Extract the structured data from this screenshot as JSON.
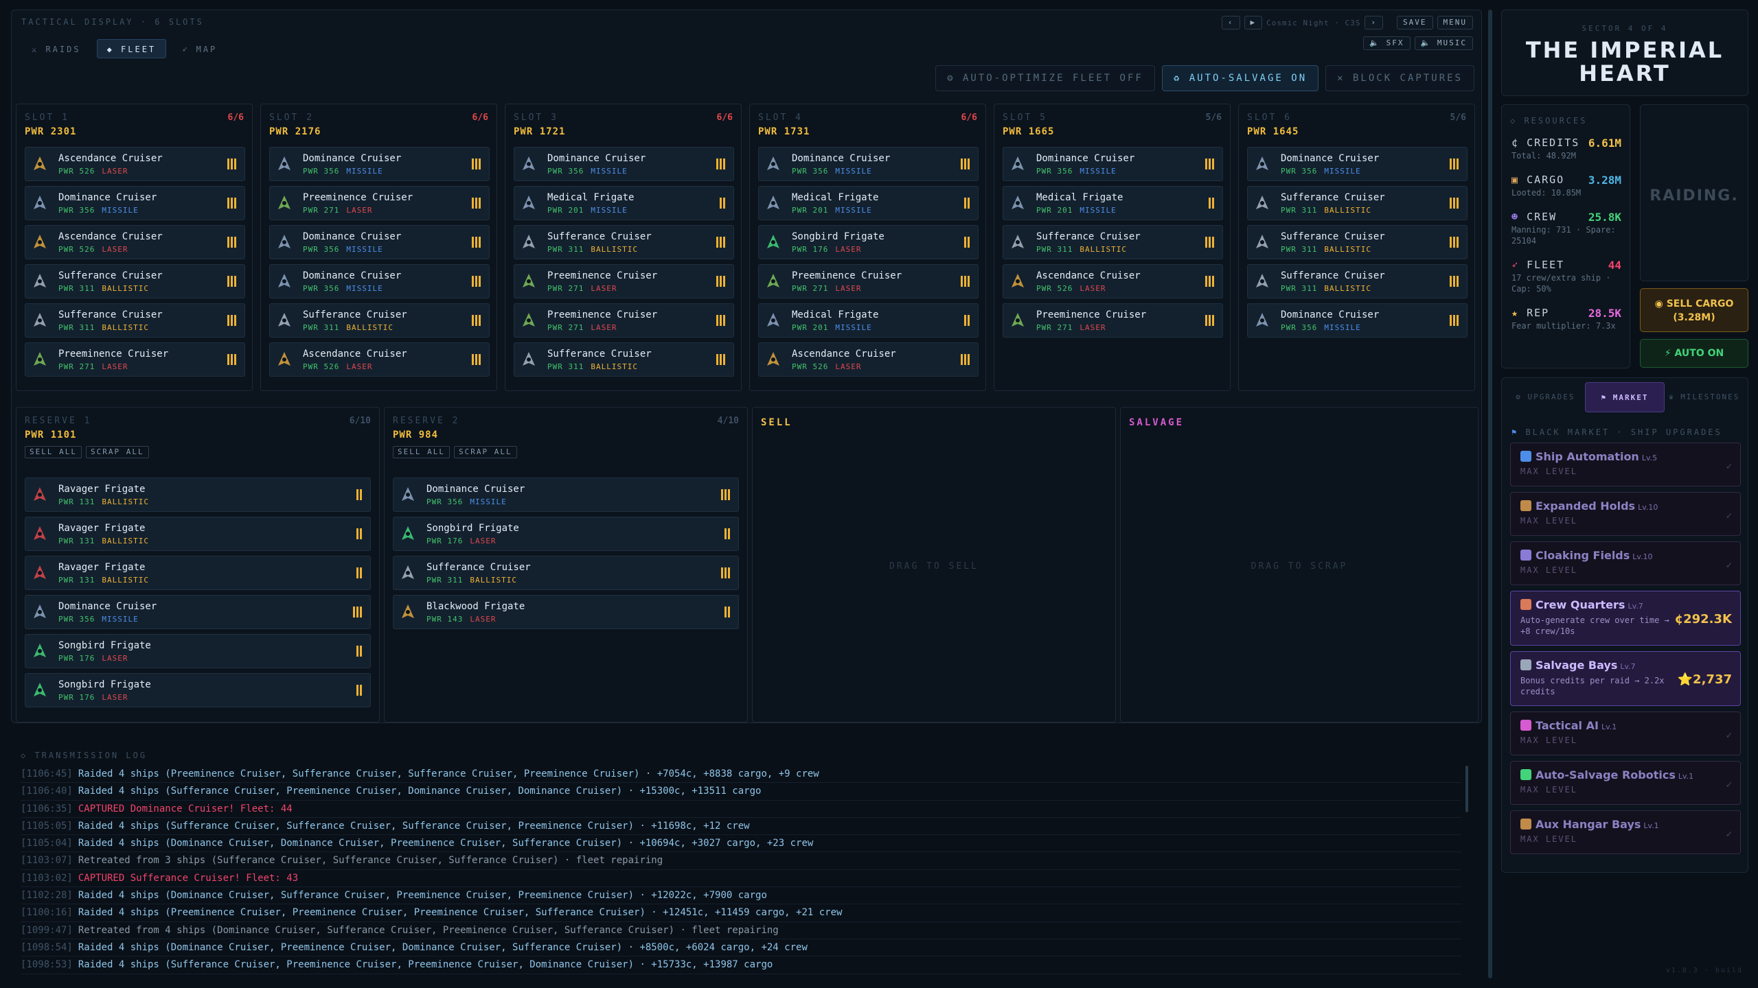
{
  "header": {
    "title": "TACTICAL DISPLAY · 6 SLOTS",
    "tabs": [
      {
        "label": "RAIDS",
        "icon": "crossed-swords-icon"
      },
      {
        "label": "FLEET",
        "icon": "diamond-icon",
        "active": true
      },
      {
        "label": "MAP",
        "icon": "rocket-icon"
      }
    ],
    "controls": {
      "save": "SAVE",
      "menu": "MENU",
      "status": "Cosmic Night · C3S",
      "sfx": "SFX",
      "music": "MUSIC"
    }
  },
  "actions": {
    "auto_optimize": "AUTO-OPTIMIZE FLEET OFF",
    "auto_salvage": "AUTO-SALVAGE ON",
    "block_captures": "BLOCK CAPTURES"
  },
  "slots": [
    {
      "label": "SLOT 1",
      "count": "6/6",
      "pwr": "PWR 2301",
      "ships": [
        {
          "name": "Ascendance Cruiser",
          "pwr": "PWR 526",
          "type": "LASER",
          "bars": 3
        },
        {
          "name": "Dominance Cruiser",
          "pwr": "PWR 356",
          "type": "MISSILE",
          "bars": 3
        },
        {
          "name": "Ascendance Cruiser",
          "pwr": "PWR 526",
          "type": "LASER",
          "bars": 3
        },
        {
          "name": "Sufferance Cruiser",
          "pwr": "PWR 311",
          "type": "BALLISTIC",
          "bars": 3
        },
        {
          "name": "Sufferance Cruiser",
          "pwr": "PWR 311",
          "type": "BALLISTIC",
          "bars": 3
        },
        {
          "name": "Preeminence Cruiser",
          "pwr": "PWR 271",
          "type": "LASER",
          "bars": 3
        }
      ]
    },
    {
      "label": "SLOT 2",
      "count": "6/6",
      "pwr": "PWR 2176",
      "ships": [
        {
          "name": "Dominance Cruiser",
          "pwr": "PWR 356",
          "type": "MISSILE",
          "bars": 3
        },
        {
          "name": "Preeminence Cruiser",
          "pwr": "PWR 271",
          "type": "LASER",
          "bars": 3
        },
        {
          "name": "Dominance Cruiser",
          "pwr": "PWR 356",
          "type": "MISSILE",
          "bars": 3
        },
        {
          "name": "Dominance Cruiser",
          "pwr": "PWR 356",
          "type": "MISSILE",
          "bars": 3
        },
        {
          "name": "Sufferance Cruiser",
          "pwr": "PWR 311",
          "type": "BALLISTIC",
          "bars": 3
        },
        {
          "name": "Ascendance Cruiser",
          "pwr": "PWR 526",
          "type": "LASER",
          "bars": 3
        }
      ]
    },
    {
      "label": "SLOT 3",
      "count": "6/6",
      "pwr": "PWR 1721",
      "ships": [
        {
          "name": "Dominance Cruiser",
          "pwr": "PWR 356",
          "type": "MISSILE",
          "bars": 3
        },
        {
          "name": "Medical Frigate",
          "pwr": "PWR 201",
          "type": "MISSILE",
          "bars": 2
        },
        {
          "name": "Sufferance Cruiser",
          "pwr": "PWR 311",
          "type": "BALLISTIC",
          "bars": 3
        },
        {
          "name": "Preeminence Cruiser",
          "pwr": "PWR 271",
          "type": "LASER",
          "bars": 3
        },
        {
          "name": "Preeminence Cruiser",
          "pwr": "PWR 271",
          "type": "LASER",
          "bars": 3
        },
        {
          "name": "Sufferance Cruiser",
          "pwr": "PWR 311",
          "type": "BALLISTIC",
          "bars": 3
        }
      ]
    },
    {
      "label": "SLOT 4",
      "count": "6/6",
      "pwr": "PWR 1731",
      "ships": [
        {
          "name": "Dominance Cruiser",
          "pwr": "PWR 356",
          "type": "MISSILE",
          "bars": 3
        },
        {
          "name": "Medical Frigate",
          "pwr": "PWR 201",
          "type": "MISSILE",
          "bars": 2
        },
        {
          "name": "Songbird Frigate",
          "pwr": "PWR 176",
          "type": "LASER",
          "bars": 2
        },
        {
          "name": "Preeminence Cruiser",
          "pwr": "PWR 271",
          "type": "LASER",
          "bars": 3
        },
        {
          "name": "Medical Frigate",
          "pwr": "PWR 201",
          "type": "MISSILE",
          "bars": 2
        },
        {
          "name": "Ascendance Cruiser",
          "pwr": "PWR 526",
          "type": "LASER",
          "bars": 3
        }
      ]
    },
    {
      "label": "SLOT 5",
      "count": "5/6",
      "pwr": "PWR 1665",
      "ships": [
        {
          "name": "Dominance Cruiser",
          "pwr": "PWR 356",
          "type": "MISSILE",
          "bars": 3
        },
        {
          "name": "Medical Frigate",
          "pwr": "PWR 201",
          "type": "MISSILE",
          "bars": 2
        },
        {
          "name": "Sufferance Cruiser",
          "pwr": "PWR 311",
          "type": "BALLISTIC",
          "bars": 3
        },
        {
          "name": "Ascendance Cruiser",
          "pwr": "PWR 526",
          "type": "LASER",
          "bars": 3
        },
        {
          "name": "Preeminence Cruiser",
          "pwr": "PWR 271",
          "type": "LASER",
          "bars": 3
        }
      ]
    },
    {
      "label": "SLOT 6",
      "count": "5/6",
      "pwr": "PWR 1645",
      "ships": [
        {
          "name": "Dominance Cruiser",
          "pwr": "PWR 356",
          "type": "MISSILE",
          "bars": 3
        },
        {
          "name": "Sufferance Cruiser",
          "pwr": "PWR 311",
          "type": "BALLISTIC",
          "bars": 3
        },
        {
          "name": "Sufferance Cruiser",
          "pwr": "PWR 311",
          "type": "BALLISTIC",
          "bars": 3
        },
        {
          "name": "Sufferance Cruiser",
          "pwr": "PWR 311",
          "type": "BALLISTIC",
          "bars": 3
        },
        {
          "name": "Dominance Cruiser",
          "pwr": "PWR 356",
          "type": "MISSILE",
          "bars": 3
        }
      ]
    }
  ],
  "reserves": [
    {
      "label": "RESERVE 1",
      "count": "6/10",
      "pwr": "PWR 1101",
      "sell_all": "SELL ALL",
      "scrap_all": "SCRAP ALL",
      "ships": [
        {
          "name": "Ravager Frigate",
          "pwr": "PWR 131",
          "type": "BALLISTIC",
          "bars": 2
        },
        {
          "name": "Ravager Frigate",
          "pwr": "PWR 131",
          "type": "BALLISTIC",
          "bars": 2
        },
        {
          "name": "Ravager Frigate",
          "pwr": "PWR 131",
          "type": "BALLISTIC",
          "bars": 2
        },
        {
          "name": "Dominance Cruiser",
          "pwr": "PWR 356",
          "type": "MISSILE",
          "bars": 3
        },
        {
          "name": "Songbird Frigate",
          "pwr": "PWR 176",
          "type": "LASER",
          "bars": 2
        },
        {
          "name": "Songbird Frigate",
          "pwr": "PWR 176",
          "type": "LASER",
          "bars": 2
        }
      ]
    },
    {
      "label": "RESERVE 2",
      "count": "4/10",
      "pwr": "PWR 984",
      "sell_all": "SELL ALL",
      "scrap_all": "SCRAP ALL",
      "ships": [
        {
          "name": "Dominance Cruiser",
          "pwr": "PWR 356",
          "type": "MISSILE",
          "bars": 3
        },
        {
          "name": "Songbird Frigate",
          "pwr": "PWR 176",
          "type": "LASER",
          "bars": 2
        },
        {
          "name": "Sufferance Cruiser",
          "pwr": "PWR 311",
          "type": "BALLISTIC",
          "bars": 3
        },
        {
          "name": "Blackwood Frigate",
          "pwr": "PWR 143",
          "type": "LASER",
          "bars": 2
        }
      ]
    }
  ],
  "drop_zones": {
    "sell": {
      "label": "SELL",
      "hint": "DRAG TO SELL"
    },
    "salvage": {
      "label": "SALVAGE",
      "hint": "DRAG TO SCRAP"
    }
  },
  "log": {
    "title": "TRANSMISSION LOG",
    "lines": [
      {
        "ts": "[1106:45]",
        "text": "Raided 4 ships (Preeminence Cruiser, Sufferance Cruiser, Sufferance Cruiser, Preeminence Cruiser) · +7054c, +8838 cargo, +9 crew",
        "kind": "raid"
      },
      {
        "ts": "[1106:40]",
        "text": "Raided 4 ships (Sufferance Cruiser, Preeminence Cruiser, Dominance Cruiser, Dominance Cruiser) · +15300c, +13511 cargo",
        "kind": "raid"
      },
      {
        "ts": "[1106:35]",
        "text": "CAPTURED Dominance Cruiser! Fleet: 44",
        "kind": "capt"
      },
      {
        "ts": "[1105:05]",
        "text": "Raided 4 ships (Sufferance Cruiser, Sufferance Cruiser, Sufferance Cruiser, Preeminence Cruiser) · +11698c, +12 crew",
        "kind": "raid"
      },
      {
        "ts": "[1105:04]",
        "text": "Raided 4 ships (Dominance Cruiser, Dominance Cruiser, Preeminence Cruiser, Sufferance Cruiser) · +10694c, +3027 cargo, +23 crew",
        "kind": "raid"
      },
      {
        "ts": "[1103:07]",
        "text": "Retreated from 3 ships (Sufferance Cruiser, Sufferance Cruiser, Sufferance Cruiser) · fleet repairing",
        "kind": "retr"
      },
      {
        "ts": "[1103:02]",
        "text": "CAPTURED Sufferance Cruiser! Fleet: 43",
        "kind": "capt"
      },
      {
        "ts": "[1102:28]",
        "text": "Raided 4 ships (Dominance Cruiser, Sufferance Cruiser, Preeminence Cruiser, Preeminence Cruiser) · +12022c, +7900 cargo",
        "kind": "raid"
      },
      {
        "ts": "[1100:16]",
        "text": "Raided 4 ships (Preeminence Cruiser, Preeminence Cruiser, Preeminence Cruiser, Sufferance Cruiser) · +12451c, +11459 cargo, +21 crew",
        "kind": "raid"
      },
      {
        "ts": "[1099:47]",
        "text": "Retreated from 4 ships (Dominance Cruiser, Sufferance Cruiser, Preeminence Cruiser, Sufferance Cruiser) · fleet repairing",
        "kind": "retr"
      },
      {
        "ts": "[1098:54]",
        "text": "Raided 4 ships (Dominance Cruiser, Preeminence Cruiser, Dominance Cruiser, Sufferance Cruiser) · +8500c, +6024 cargo, +24 crew",
        "kind": "raid"
      },
      {
        "ts": "[1098:53]",
        "text": "Raided 4 ships (Sufferance Cruiser, Preeminence Cruiser, Preeminence Cruiser, Dominance Cruiser) · +15733c, +13987 cargo",
        "kind": "raid"
      }
    ]
  },
  "sector": {
    "label": "SECTOR 4 OF 4",
    "name": "THE IMPERIAL HEART"
  },
  "resources": {
    "title": "RESOURCES",
    "credits": {
      "label": "CREDITS",
      "value": "6.61M",
      "sub": "Total: 48.92M",
      "color": "#f2c24b"
    },
    "cargo": {
      "label": "CARGO",
      "value": "3.28M",
      "sub": "Looted: 10.85M",
      "color": "#4fb7e8"
    },
    "crew": {
      "label": "CREW",
      "value": "25.8K",
      "sub": "Manning: 731 · Spare: 25104",
      "color": "#43d37a"
    },
    "fleet": {
      "label": "FLEET",
      "value": "44",
      "sub": "17 crew/extra ship · Cap: 50%",
      "color": "#f2456c"
    },
    "rep": {
      "label": "REP",
      "value": "28.5K",
      "sub": "Fear multiplier: 7.3x",
      "color": "#e86ae0"
    }
  },
  "raid_status": "RAIDING.",
  "sell_cargo": {
    "label": "SELL CARGO",
    "amount": "(3.28M)"
  },
  "auto_on": "AUTO ON",
  "upgrade_tabs": [
    {
      "label": "UPGRADES"
    },
    {
      "label": "MARKET",
      "active": true
    },
    {
      "label": "MILESTONES"
    }
  ],
  "market_title": "BLACK MARKET · SHIP UPGRADES",
  "upgrades": [
    {
      "name": "Ship Automation",
      "lv": "Lv.5",
      "sub": "MAX LEVEL",
      "icon_color": "#4d8ee8"
    },
    {
      "name": "Expanded Holds",
      "lv": "Lv.10",
      "sub": "MAX LEVEL",
      "icon_color": "#c08b4a"
    },
    {
      "name": "Cloaking Fields",
      "lv": "Lv.10",
      "sub": "MAX LEVEL",
      "icon_color": "#8a7bd6"
    },
    {
      "name": "Crew Quarters",
      "lv": "Lv.7",
      "sub": "Auto-generate crew over time → +8 crew/10s",
      "cost": "¢292.3K",
      "cost_color": "#f2c24b",
      "avail": true,
      "icon_color": "#d97a5a"
    },
    {
      "name": "Salvage Bays",
      "lv": "Lv.7",
      "sub": "Bonus credits per raid → 2.2x credits",
      "cost": "⭐2,737",
      "cost_color": "#f2c24b",
      "avail": true,
      "icon_color": "#9aa7b8"
    },
    {
      "name": "Tactical AI",
      "lv": "Lv.1",
      "sub": "MAX LEVEL",
      "icon_color": "#d65ad0"
    },
    {
      "name": "Auto-Salvage Robotics",
      "lv": "Lv.1",
      "sub": "MAX LEVEL",
      "icon_color": "#43d37a"
    },
    {
      "name": "Aux Hangar Bays",
      "lv": "Lv.1",
      "sub": "MAX LEVEL",
      "icon_color": "#c08b4a"
    }
  ],
  "version": "v1.8.3 · build"
}
